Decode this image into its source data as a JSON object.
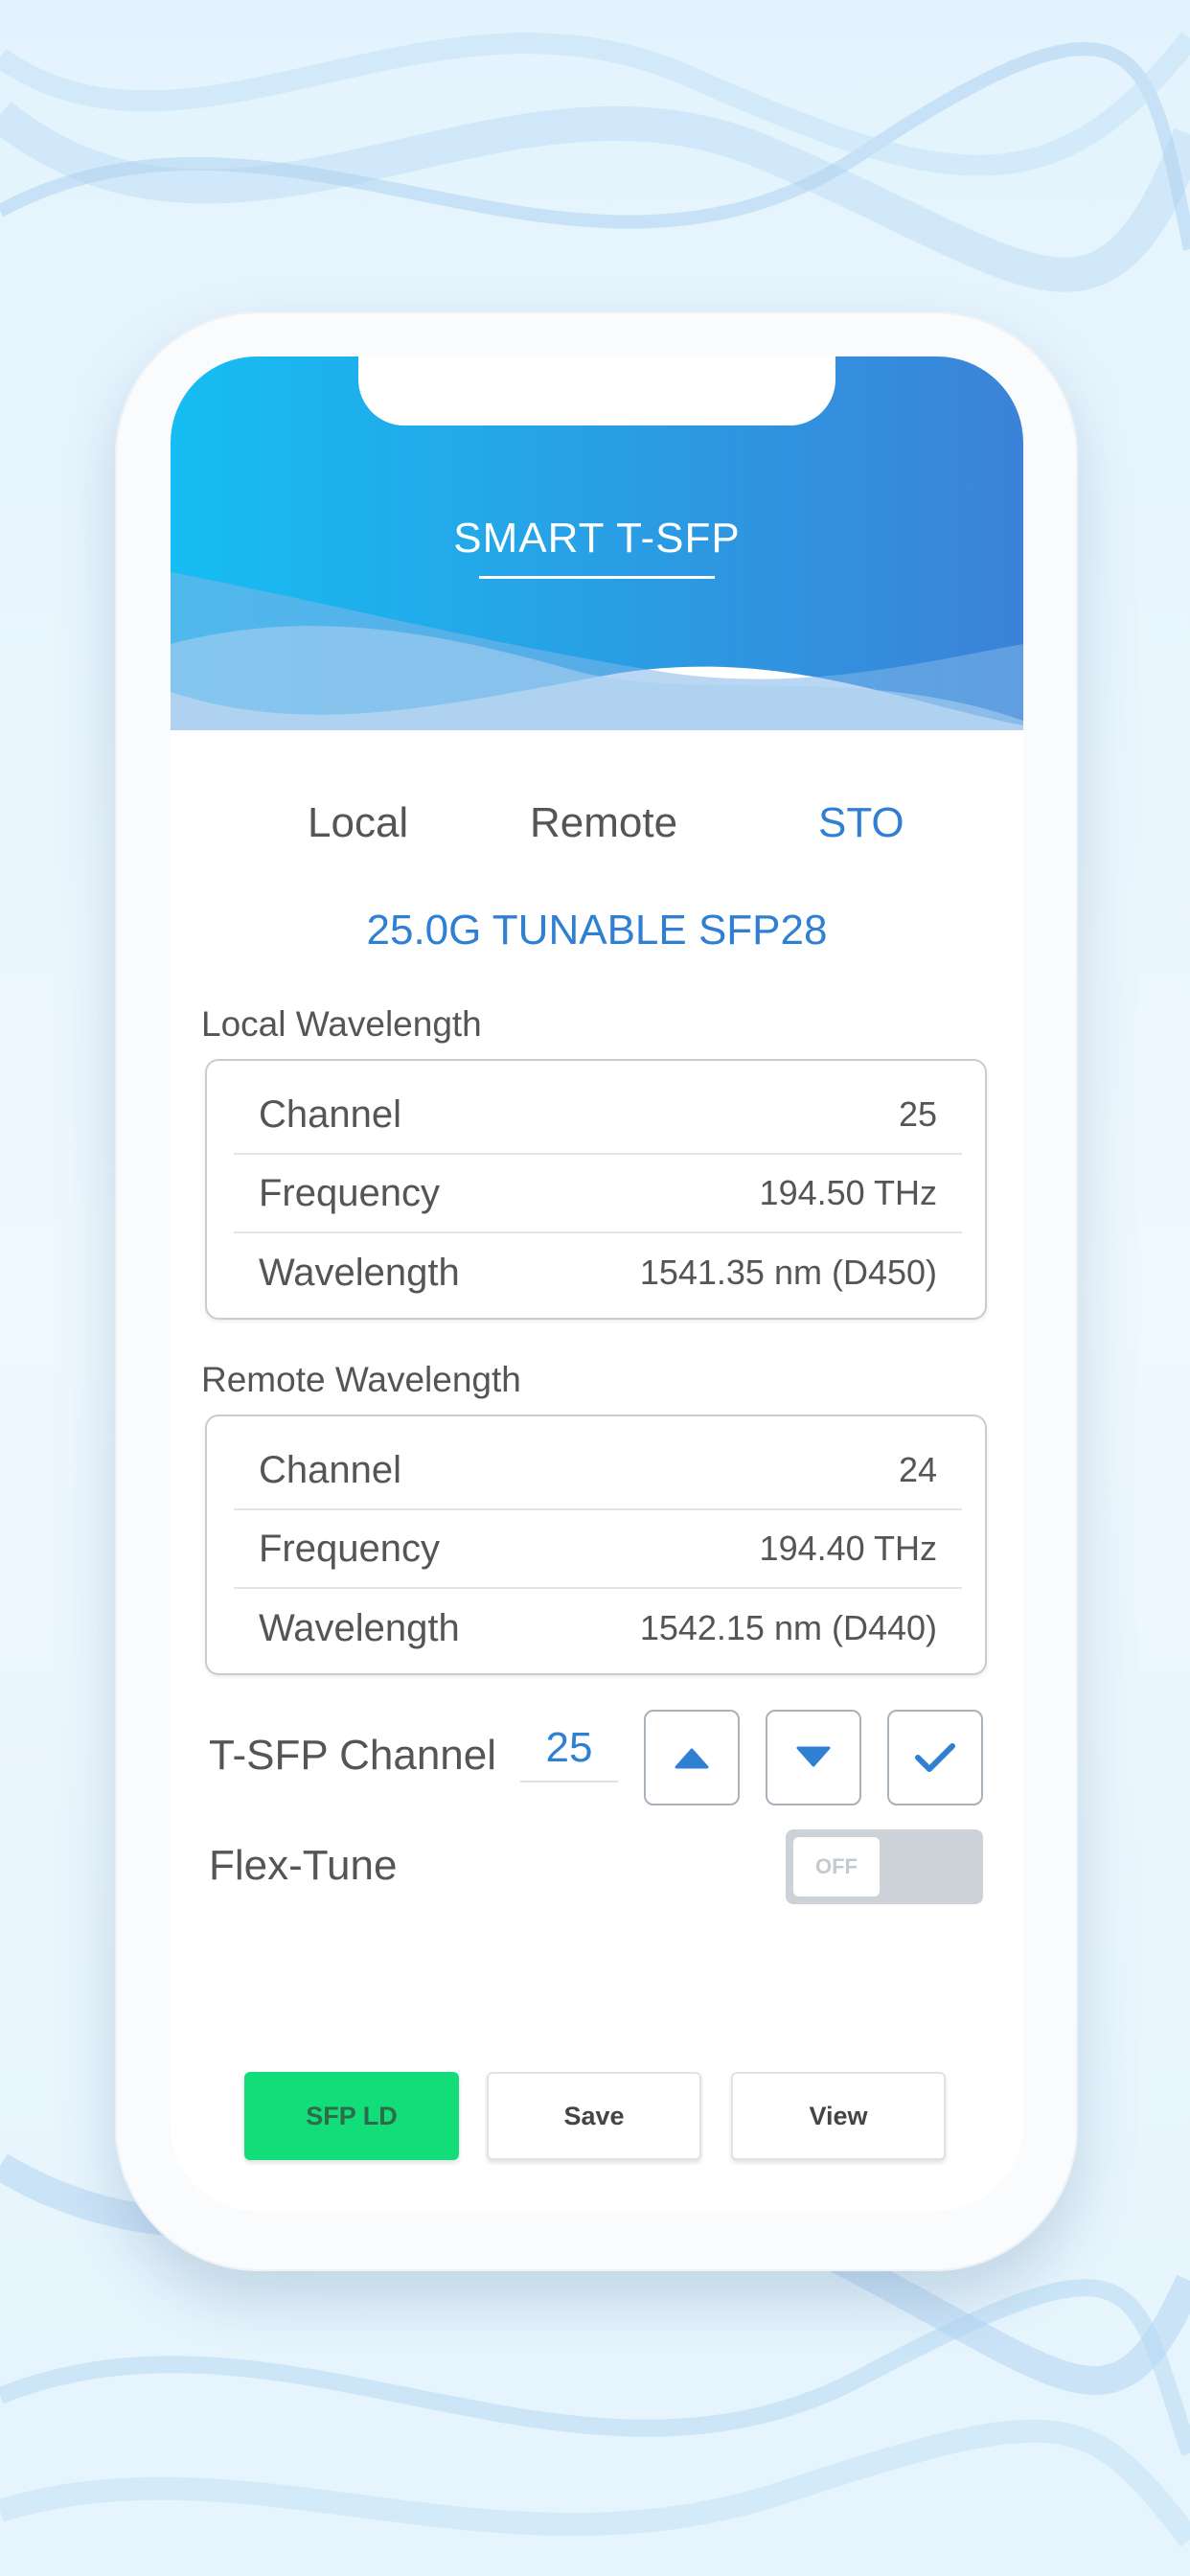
{
  "colors": {
    "accent": "#2f7fd3",
    "header_start": "#16bdf3",
    "header_end": "#3b82d8",
    "green": "#13dd78",
    "toggle_off": "#ccd2d7"
  },
  "header": {
    "title": "SMART T-SFP"
  },
  "tabs": [
    {
      "label": "Local",
      "active": false
    },
    {
      "label": "Remote",
      "active": false
    },
    {
      "label": "STO",
      "active": true
    }
  ],
  "module": {
    "title": "25.0G TUNABLE SFP28"
  },
  "local": {
    "label": "Local Wavelength",
    "rows": [
      {
        "key": "Channel",
        "value": "25"
      },
      {
        "key": "Frequency",
        "value": "194.50 THz"
      },
      {
        "key": "Wavelength",
        "value": "1541.35 nm (D450)"
      }
    ]
  },
  "remote": {
    "label": "Remote Wavelength",
    "rows": [
      {
        "key": "Channel",
        "value": "24"
      },
      {
        "key": "Frequency",
        "value": "194.40 THz"
      },
      {
        "key": "Wavelength",
        "value": "1542.15 nm (D440)"
      }
    ]
  },
  "tsfp": {
    "label": "T-SFP Channel",
    "value": "25",
    "up_icon": "triangle-up-icon",
    "down_icon": "triangle-down-icon",
    "confirm_icon": "check-icon"
  },
  "flex_tune": {
    "label": "Flex-Tune",
    "state": "OFF"
  },
  "buttons": {
    "sfp_ld": "SFP LD",
    "save": "Save",
    "view": "View"
  }
}
